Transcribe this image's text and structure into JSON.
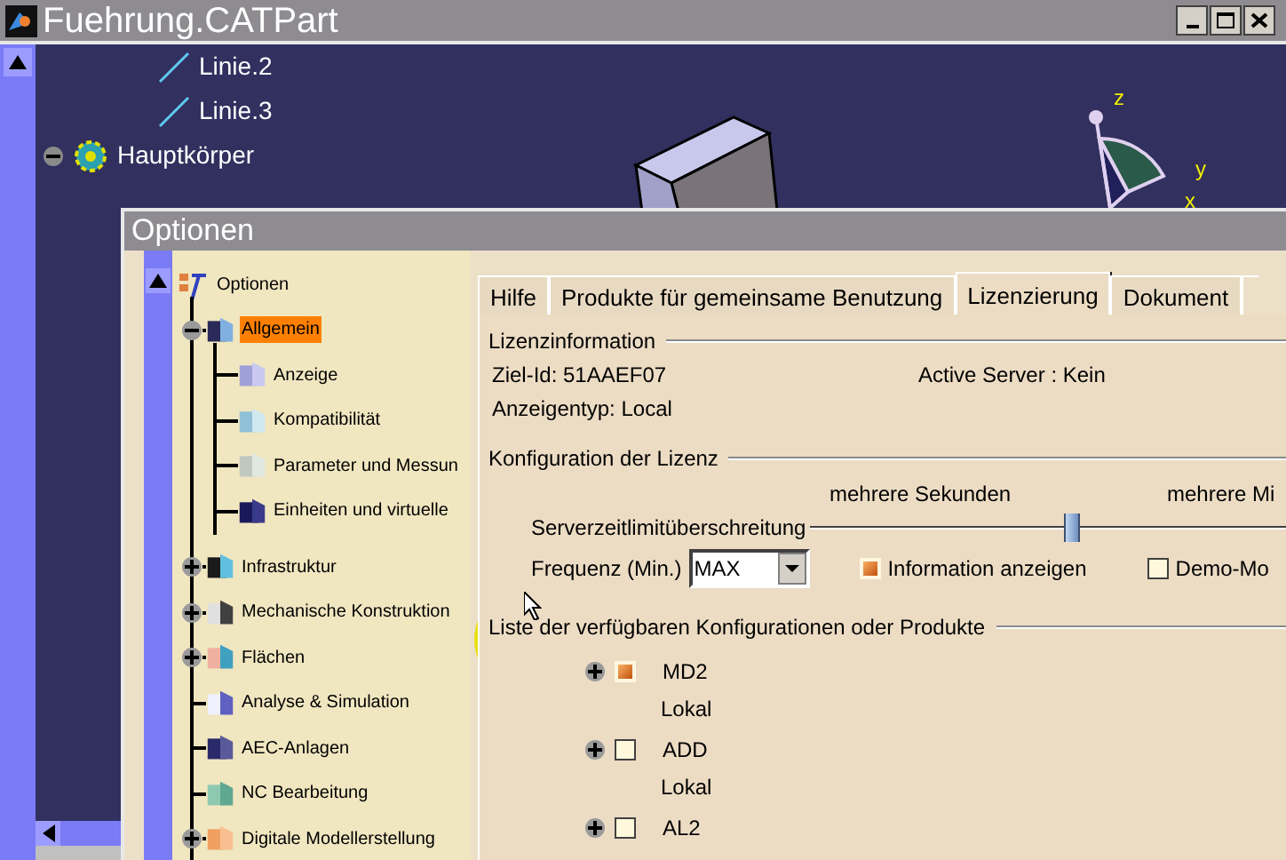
{
  "window": {
    "title": "Fuehrung.CATPart"
  },
  "spec_tree": [
    {
      "label": "Linie.2"
    },
    {
      "label": "Linie.3"
    },
    {
      "label": "Hauptkörper",
      "expanded": true
    }
  ],
  "viewer": {
    "axes": [
      "z",
      "y",
      "x"
    ]
  },
  "dialog": {
    "title": "Optionen",
    "tree": {
      "label": "Optionen",
      "children": [
        {
          "label": "Allgemein",
          "selected": true,
          "expanded": true,
          "children": [
            {
              "label": "Anzeige",
              "selected": false
            },
            {
              "label": "Kompatibilität",
              "selected": false
            },
            {
              "label": "Parameter und Messun",
              "selected": false
            },
            {
              "label": "Einheiten und virtuelle",
              "selected": false
            }
          ]
        },
        {
          "label": "Infrastruktur",
          "selected": false,
          "expanded": false
        },
        {
          "label": "Mechanische Konstruktion",
          "selected": false,
          "expanded": false
        },
        {
          "label": "Flächen",
          "selected": false,
          "expanded": false
        },
        {
          "label": "Analyse & Simulation",
          "selected": false
        },
        {
          "label": "AEC-Anlagen",
          "selected": false
        },
        {
          "label": "NC Bearbeitung",
          "selected": false
        },
        {
          "label": "Digitale Modellerstellung",
          "selected": false,
          "expanded": false
        }
      ]
    },
    "tabs": [
      {
        "label": "Hilfe",
        "selected": false
      },
      {
        "label": "Produkte für gemeinsame Benutzung",
        "selected": false
      },
      {
        "label": "Lizenzierung",
        "selected": true
      },
      {
        "label": "Dokument",
        "selected": false
      }
    ],
    "license_info": {
      "heading": "Lizenzinformation",
      "target_id": "Ziel-Id: 51AAEF07",
      "active_server": "Active Server : Kein",
      "display_type": "Anzeigentyp: Local"
    },
    "license_config": {
      "heading": "Konfiguration der Lizenz",
      "scale_left": "mehrere Sekunden",
      "scale_right": "mehrere Mi",
      "timeout": {
        "label": "Serverzeitlimitüberschreitung",
        "level": 0.55
      },
      "frequency": {
        "label": "Frequenz (Min.)",
        "value": "MAX"
      },
      "options": [
        {
          "label": "Information anzeigen",
          "checked": true
        },
        {
          "label": "Demo-Mo",
          "checked": false
        }
      ]
    },
    "products": {
      "heading": "Liste der verfügbaren Konfigurationen oder Produkte",
      "items": [
        {
          "name": "MD2",
          "location": "Lokal",
          "checked": true,
          "expanded": false
        },
        {
          "name": "ADD",
          "location": "Lokal",
          "checked": false,
          "expanded": false
        },
        {
          "name": "AL2",
          "checked": false,
          "expanded": false
        }
      ]
    }
  }
}
